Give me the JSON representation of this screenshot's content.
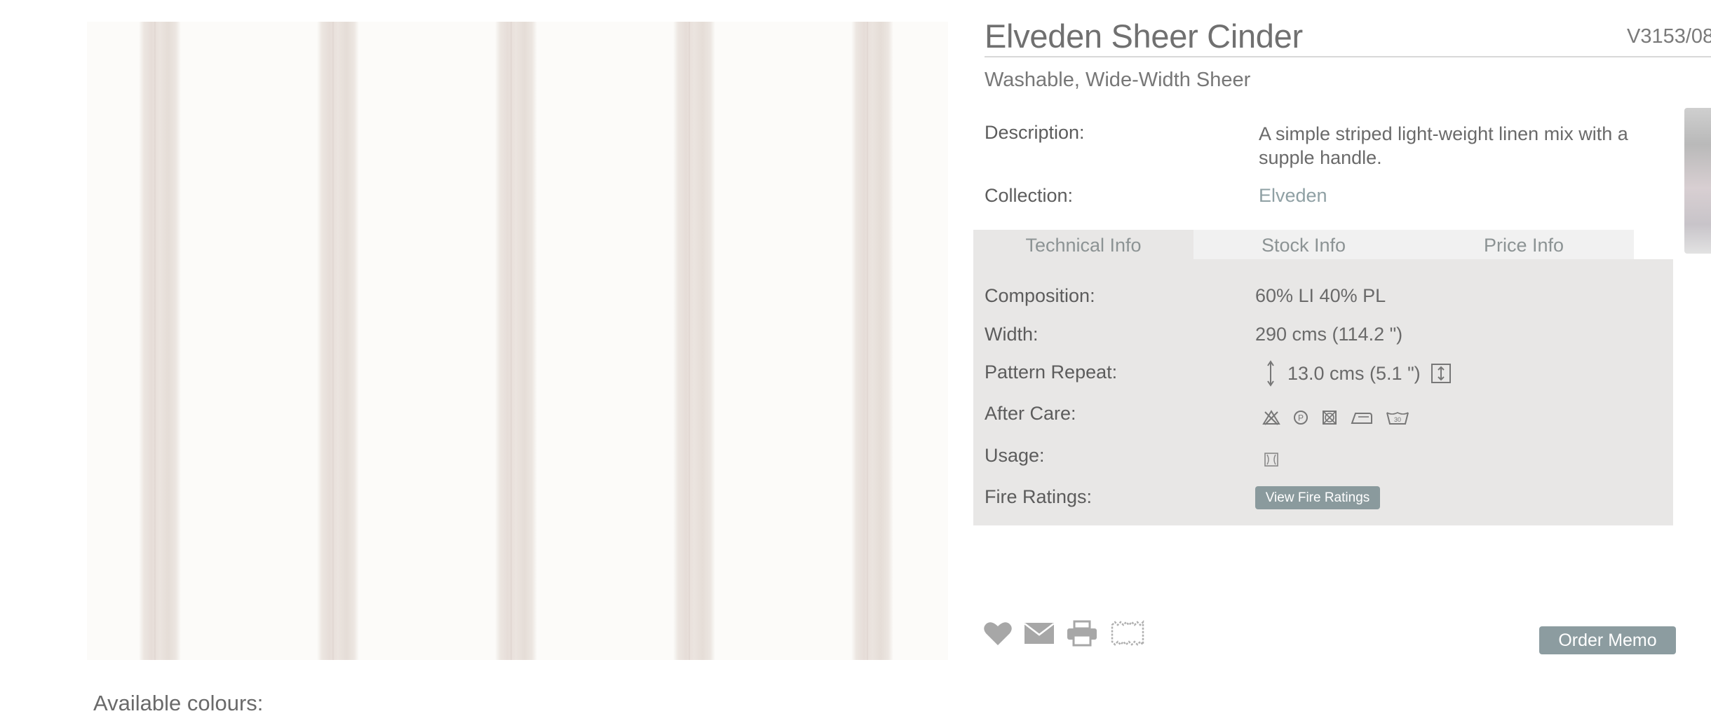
{
  "product": {
    "title": "Elveden Sheer Cinder",
    "code": "V3153/08",
    "subtitle": "Washable, Wide-Width Sheer",
    "description_label": "Description:",
    "description": "A simple striped light-weight linen mix with a supple handle.",
    "collection_label": "Collection:",
    "collection": "Elveden"
  },
  "tabs": [
    {
      "label": "Technical Info",
      "active": true
    },
    {
      "label": "Stock Info",
      "active": false
    },
    {
      "label": "Price Info",
      "active": false
    }
  ],
  "technical": {
    "composition_label": "Composition:",
    "composition": "60% LI 40% PL",
    "width_label": "Width:",
    "width": "290 cms (114.2 \")",
    "repeat_label": "Pattern Repeat:",
    "repeat": "13.0 cms (5.1 \")",
    "aftercare_label": "After Care:",
    "aftercare_icons": [
      "do-not-bleach-icon",
      "professional-dry-clean-icon",
      "do-not-tumble-dry-icon",
      "cool-iron-icon",
      "wash-30-icon"
    ],
    "aftercare_wash_temp": "30",
    "usage_label": "Usage:",
    "usage_icons": [
      "curtain-usage-icon"
    ],
    "fire_label": "Fire Ratings:",
    "fire_button": "View Fire Ratings"
  },
  "actions": {
    "icons": [
      "heart-icon",
      "mail-icon",
      "print-icon",
      "swatch-icon"
    ],
    "order_memo": "Order Memo"
  },
  "available_colours": "Available colours:",
  "colors": {
    "accent_button": "#8a9a9d",
    "panel_bg": "#e8e7e6",
    "link": "#8fa0a4"
  }
}
